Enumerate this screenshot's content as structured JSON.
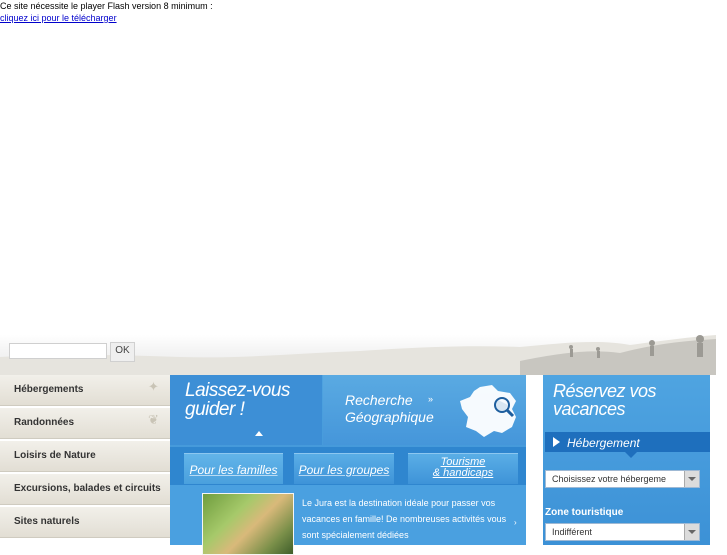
{
  "flash_notice": {
    "message": "Ce site nécessite le player Flash version 8 minimum :",
    "link": "cliquez ici pour le télécharger"
  },
  "search": {
    "value": "",
    "button": "OK"
  },
  "left_menu": {
    "items": [
      {
        "label": "Hébergements"
      },
      {
        "label": "Randonnées"
      },
      {
        "label": "Loisirs de Nature"
      },
      {
        "label": "Excursions, balades et circuits"
      },
      {
        "label": "Sites naturels"
      }
    ]
  },
  "guide": {
    "title": "Laissez-vous guider !"
  },
  "geo": {
    "title": "Recherche Géographique",
    "arrow": "»"
  },
  "tabs": [
    {
      "label": "Pour les familles"
    },
    {
      "label": "Pour les groupes"
    },
    {
      "line1": "Tourisme",
      "line2": "& handicaps"
    }
  ],
  "content": {
    "text": "Le Jura est la destination idéale pour passer vos vacances en famille! De nombreuses activités vous sont spécialement dédiées",
    "arrow": "›"
  },
  "booking": {
    "title": "Réservez vos vacances",
    "hebergement_label": "Hébergement",
    "select_hebergement": "Choisissez votre hébergeme",
    "zone_label": "Zone touristique",
    "select_zone": "Indifférent"
  },
  "colors": {
    "panel_blue": "#3a8fd4",
    "dark_blue": "#1e6fbd",
    "link_blue": "#0000cc"
  }
}
